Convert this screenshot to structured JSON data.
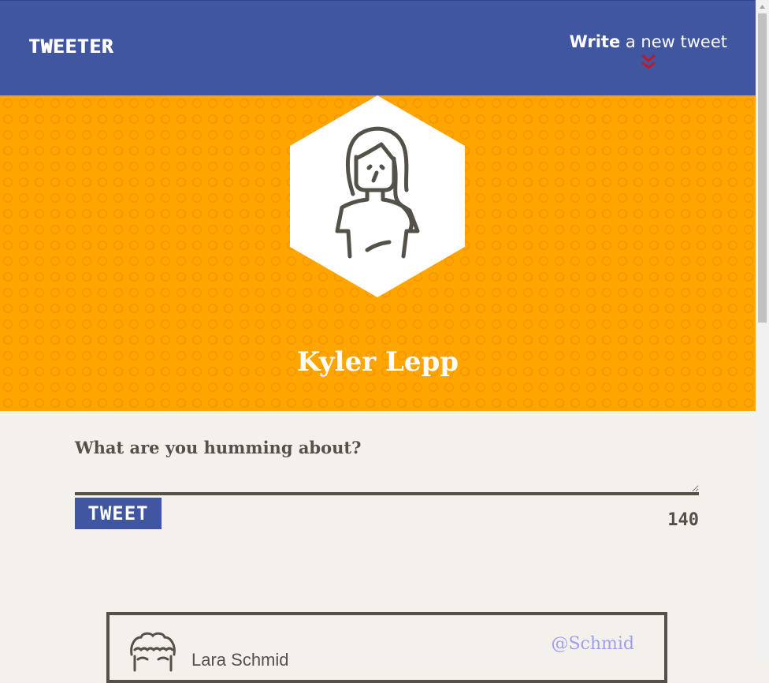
{
  "nav": {
    "brand": "TWEETER",
    "compose_bold": "Write",
    "compose_rest": " a new tweet",
    "chevron_icon": "double-chevron-down",
    "chevron_color": "#c0192b"
  },
  "profile": {
    "name": "Kyler Lepp",
    "avatar_icon": "woman-avatar"
  },
  "compose": {
    "label": "What are you humming about?",
    "input_value": "",
    "button_label": "TWEET",
    "counter": "140"
  },
  "tweets": [
    {
      "name": "Lara Schmid",
      "handle": "@Schmid",
      "avatar_icon": "curly-hair-avatar"
    }
  ],
  "colors": {
    "nav_bg": "#4056a1",
    "hero_bg": "#ffa500",
    "page_bg": "#f4f1ec",
    "text_dark": "#545149",
    "handle": "#a09ef0"
  }
}
